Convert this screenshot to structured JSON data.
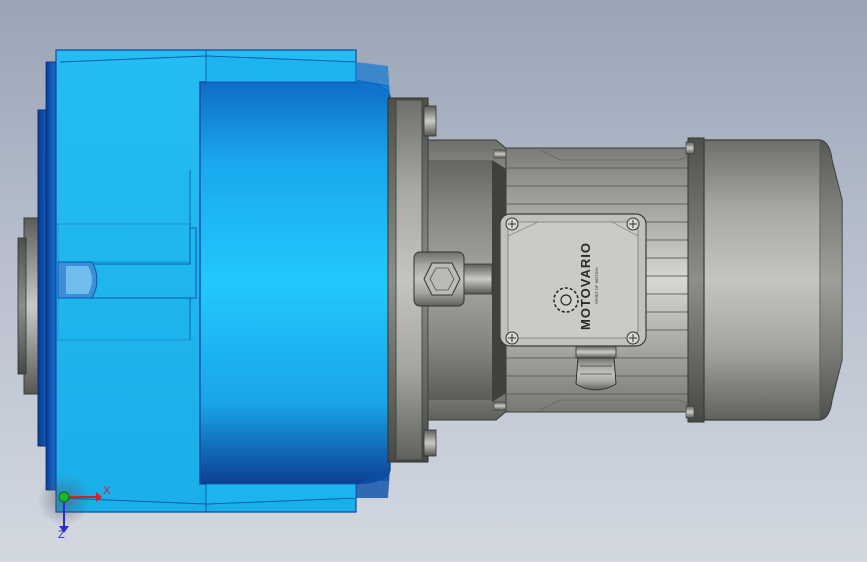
{
  "viewport": {
    "background": [
      "#9aa4b6",
      "#d3d8e0"
    ]
  },
  "model": {
    "brand_plate_text": "MOTOVARIO",
    "brand_plate_subtext": "SPIRIT OF MOTION",
    "colors": {
      "gearbox_blue": "#1fb9f2",
      "gearbox_dark_blue": "#0d4fa3",
      "motor_grey": "#8f918c",
      "terminal_box": "#c8c8c4"
    }
  },
  "triad": {
    "x_label": "X",
    "z_label": "Z",
    "x_color": "#d4202a",
    "y_color": "#1db32d",
    "z_color": "#2a2fc9"
  }
}
